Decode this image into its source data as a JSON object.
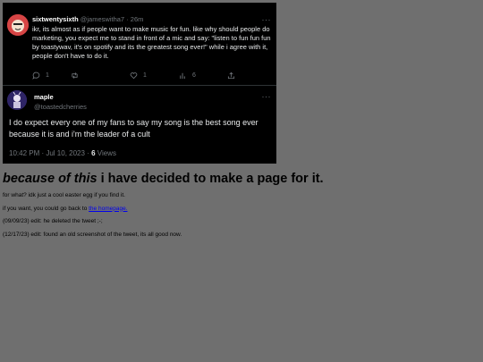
{
  "tweet_reply": {
    "name": "sixtwentysixth",
    "handle": "@jameswitha7",
    "separator": "·",
    "time_ago": "26m",
    "text": "ikr, its almost as if people want to make music for fun. like why should people do marketing, you expect me to stand in front of a mic and say: \"listen to fun fun fun by toastywav, it's on spotify and its the greatest song ever!\" while i agree with it, people don't have to do it.",
    "reply_count": "1",
    "like_count": "1",
    "view_count": "6",
    "icons": [
      "more-icon",
      "reply-icon",
      "retweet-icon",
      "like-icon",
      "views-icon",
      "share-icon"
    ]
  },
  "tweet_main": {
    "name": "maple",
    "handle": "@toastedcherries",
    "text": "I do expect every one of my fans to say my song is the best song ever because it is and i'm the leader of a cult",
    "timestamp": "10:42 PM · Jul 10, 2023 ·",
    "views_count": "6",
    "views_label": "Views"
  },
  "page": {
    "heading_em": "because of this",
    "heading_rest": " i have decided to make a page for it.",
    "line1": "for what? idk just a cool easter egg if you find it.",
    "line2_prefix": "if you want, you could go back to ",
    "line2_link": "the homepage.",
    "line3": "(09/09/23) edit: he deleted the tweet ;-;",
    "line4": "(12/17/23) edit: found an old screenshot of the tweet, its all good now."
  }
}
